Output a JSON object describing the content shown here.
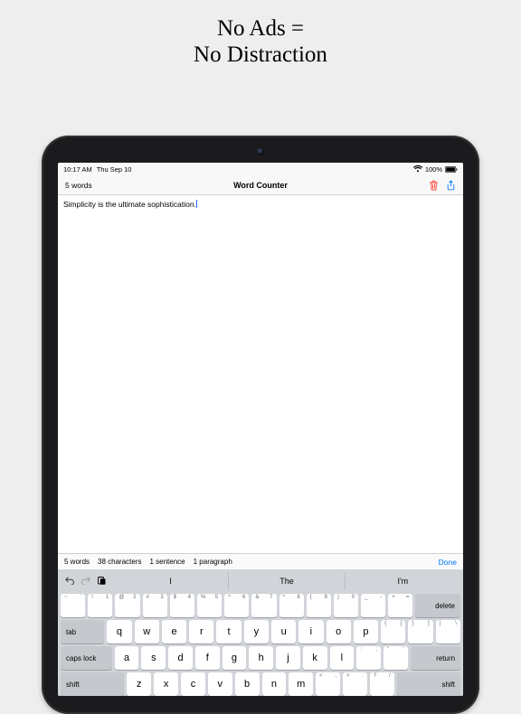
{
  "headline": {
    "line1": "No Ads =",
    "line2": "No Distraction"
  },
  "status": {
    "time": "10:17 AM",
    "date": "Thu Sep 10",
    "battery": "100%"
  },
  "nav": {
    "wordcount": "5 words",
    "title": "Word Counter"
  },
  "editor": {
    "text": "Simplicity is the ultimate sophistication."
  },
  "stats": {
    "words": "5 words",
    "chars": "38 characters",
    "sentences": "1 sentence",
    "paragraphs": "1 paragraph",
    "done": "Done"
  },
  "keyboard": {
    "suggestions": [
      "I",
      "The",
      "I'm"
    ],
    "row1": [
      {
        "main": "`",
        "hl": "~",
        "hr": "`"
      },
      {
        "main": "1",
        "hl": "!",
        "hr": "1"
      },
      {
        "main": "2",
        "hl": "@",
        "hr": "2"
      },
      {
        "main": "3",
        "hl": "#",
        "hr": "3"
      },
      {
        "main": "4",
        "hl": "$",
        "hr": "4"
      },
      {
        "main": "5",
        "hl": "%",
        "hr": "5"
      },
      {
        "main": "6",
        "hl": "^",
        "hr": "6"
      },
      {
        "main": "7",
        "hl": "&",
        "hr": "7"
      },
      {
        "main": "8",
        "hl": "*",
        "hr": "8"
      },
      {
        "main": "9",
        "hl": "(",
        "hr": "9"
      },
      {
        "main": "0",
        "hl": ")",
        "hr": "0"
      },
      {
        "main": "-",
        "hl": "_",
        "hr": "-"
      },
      {
        "main": "=",
        "hl": "+",
        "hr": "="
      }
    ],
    "delete": "delete",
    "tab": "tab",
    "row2": [
      "q",
      "w",
      "e",
      "r",
      "t",
      "y",
      "u",
      "i",
      "o",
      "p"
    ],
    "row2tail": [
      {
        "main": "[",
        "hl": "{",
        "hr": "["
      },
      {
        "main": "]",
        "hl": "}",
        "hr": "]"
      },
      {
        "main": "\\",
        "hl": "|",
        "hr": "\\"
      }
    ],
    "caps": "caps lock",
    "row3": [
      "a",
      "s",
      "d",
      "f",
      "g",
      "h",
      "j",
      "k",
      "l"
    ],
    "row3tail": [
      {
        "main": ";",
        "hl": ":",
        "hr": ";"
      },
      {
        "main": "'",
        "hl": "\"",
        "hr": "'"
      }
    ],
    "return": "return",
    "shift": "shift",
    "row4": [
      "z",
      "x",
      "c",
      "v",
      "b",
      "n",
      "m"
    ],
    "row4tail": [
      {
        "main": ",",
        "hl": "<",
        "hr": ","
      },
      {
        "main": ".",
        "hl": ">",
        "hr": "."
      },
      {
        "main": "/",
        "hl": "?",
        "hr": "/"
      }
    ]
  },
  "colors": {
    "accent": "#007aff",
    "danger": "#ff3b30"
  }
}
